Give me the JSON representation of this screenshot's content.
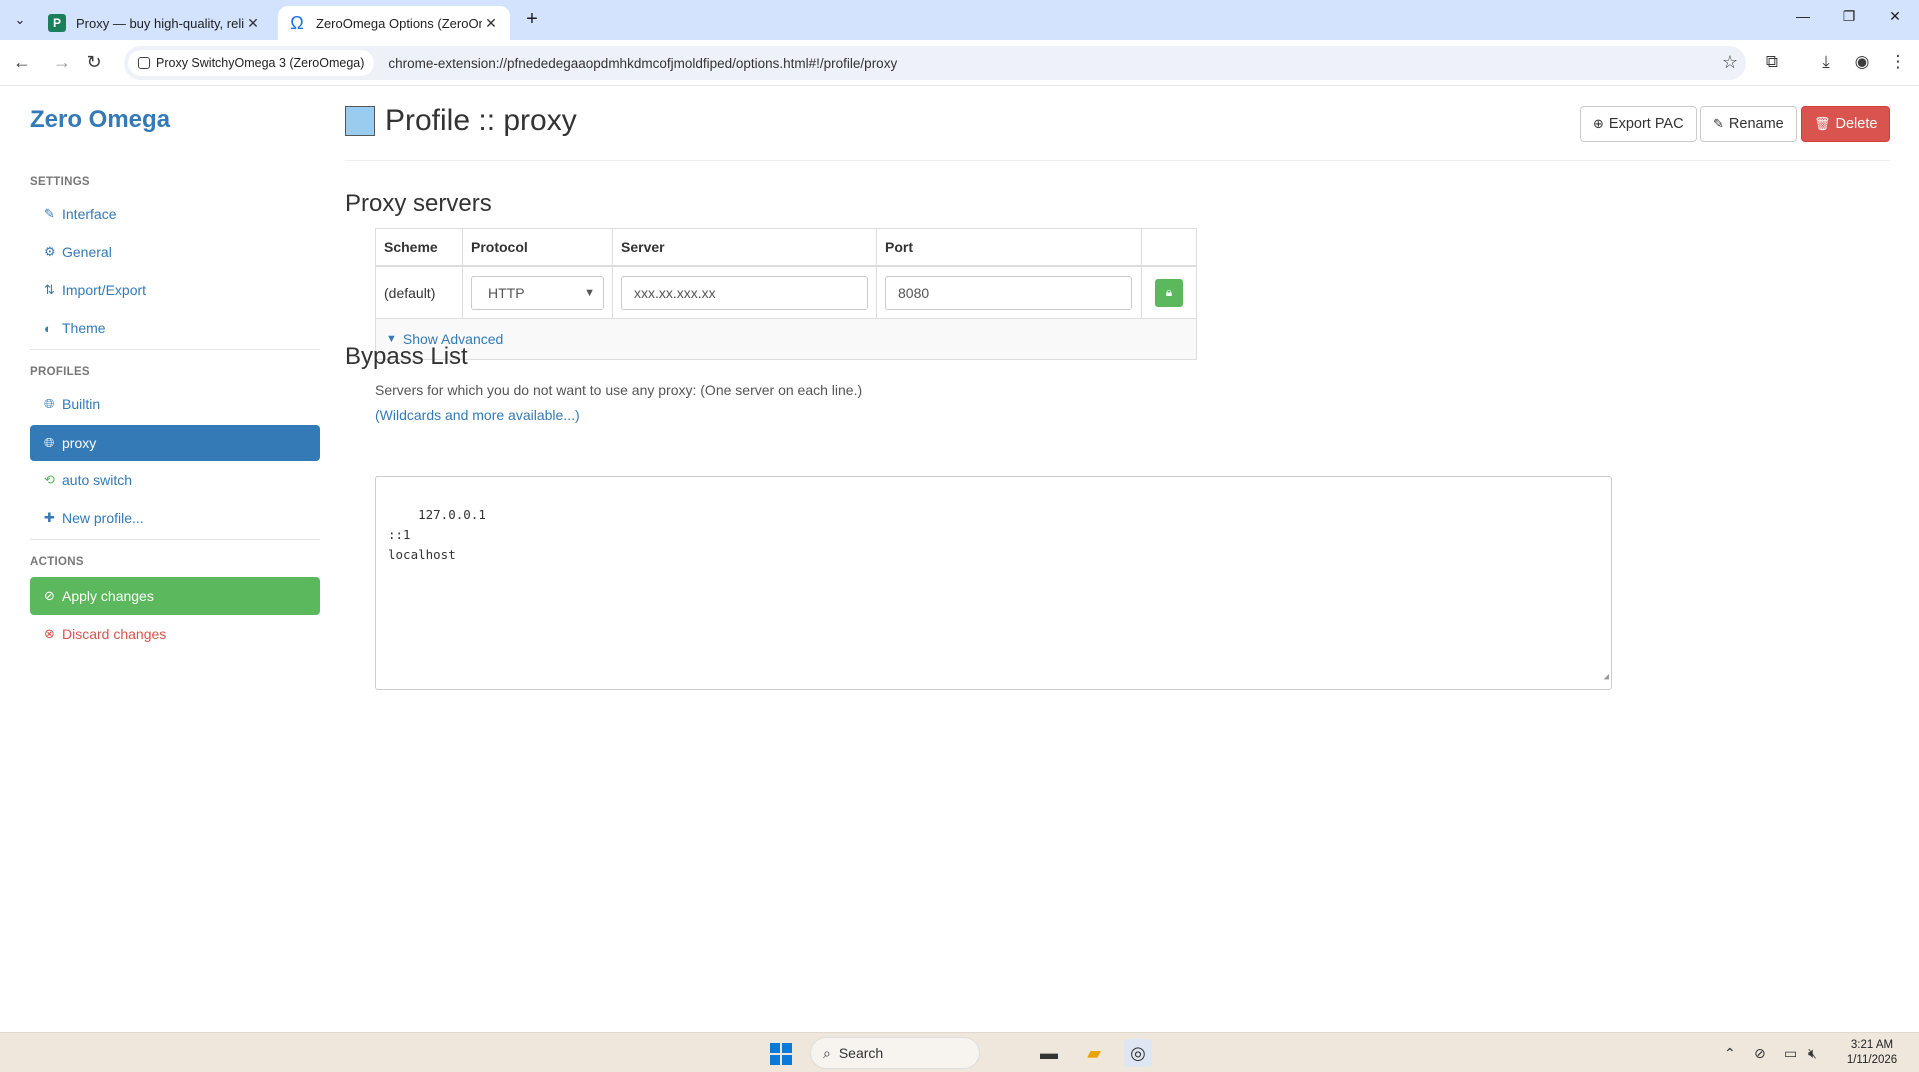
{
  "browser": {
    "tabs": [
      {
        "label": "Proxy — buy high-quality, reliab",
        "favicon_text": "P",
        "active": false
      },
      {
        "label": "ZeroOmega Options (ZeroOme",
        "active": true
      }
    ],
    "site_chip": "Proxy SwitchyOmega 3 (ZeroOmega)",
    "url": "chrome-extension://pfnededegaaopdmhkdmcofjmoldfiped/options.html#!/profile/proxy",
    "icons": [
      "tab-search-icon",
      "back-icon",
      "forward-icon",
      "reload-icon",
      "star-icon",
      "extensions-icon",
      "download-icon",
      "profile-icon",
      "menu-icon",
      "minimize-icon",
      "restore-icon",
      "close-icon"
    ]
  },
  "sidebar": {
    "brand": "Zero Omega",
    "settings_header": "SETTINGS",
    "settings_items": [
      {
        "label": "Interface",
        "icon": "wrench-icon"
      },
      {
        "label": "General",
        "icon": "gear-icon"
      },
      {
        "label": "Import/Export",
        "icon": "import-export-icon"
      },
      {
        "label": "Theme",
        "icon": "contrast-icon"
      }
    ],
    "profiles_header": "PROFILES",
    "profile_items": [
      {
        "label": "Builtin",
        "icon": "globe-icon"
      },
      {
        "label": "proxy",
        "icon": "globe-icon",
        "active": true
      },
      {
        "label": "auto switch",
        "icon": "switch-icon"
      },
      {
        "label": "New profile...",
        "icon": "plus-icon"
      }
    ],
    "actions_header": "ACTIONS",
    "apply_label": "Apply changes",
    "discard_label": "Discard changes"
  },
  "main": {
    "title": "Profile :: proxy",
    "profile_color": "#99ccee",
    "buttons": {
      "export": "Export PAC",
      "rename": "Rename",
      "delete": "Delete"
    },
    "proxy_servers": {
      "heading": "Proxy servers",
      "columns": [
        "Scheme",
        "Protocol",
        "Server",
        "Port"
      ],
      "row": {
        "scheme": "(default)",
        "protocol": "HTTP",
        "server": "xxx.xx.xxx.xx",
        "port": "8080"
      },
      "show_advanced": "Show Advanced"
    },
    "bypass": {
      "heading": "Bypass List",
      "help": "Servers for which you do not want to use any proxy: (One server on each line.)",
      "link": "(Wildcards and more available...)",
      "value": "127.0.0.1\n::1\nlocalhost"
    }
  },
  "taskbar": {
    "search_label": "Search",
    "time": "3:21 AM",
    "date": "1/11/2026"
  },
  "colors": {
    "accent": "#337ab7",
    "success": "#5cb85c",
    "danger": "#d9534f",
    "tab_strip": "#d3e3fd"
  }
}
